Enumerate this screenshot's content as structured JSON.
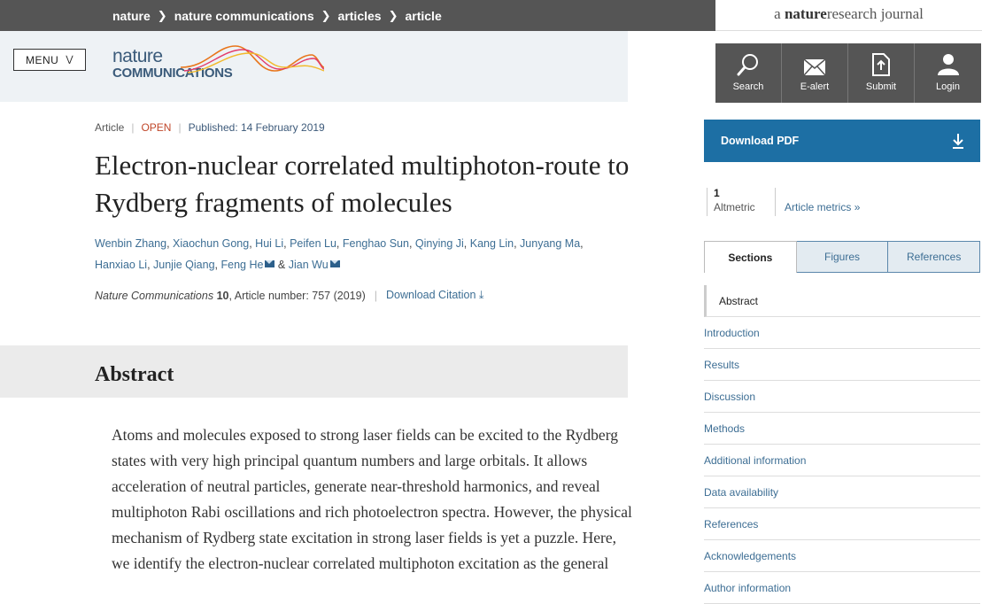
{
  "breadcrumb": [
    "nature",
    "nature communications",
    "articles",
    "article"
  ],
  "network_logo": {
    "prefix": "a",
    "brand_bold": "nature",
    "brand_rest": "research",
    "suffix": "journal"
  },
  "menu_label": "MENU",
  "journal_logo": {
    "line1": "nature",
    "line2": "COMMUNICATIONS"
  },
  "toolbar": [
    {
      "label": "Search",
      "icon": "search-icon"
    },
    {
      "label": "E-alert",
      "icon": "envelope-icon"
    },
    {
      "label": "Submit",
      "icon": "upload-icon"
    },
    {
      "label": "Login",
      "icon": "user-icon"
    }
  ],
  "article": {
    "type": "Article",
    "access": "OPEN",
    "published": "Published: 14 February 2019",
    "title": "Electron-nuclear correlated multiphoton-route to Rydberg fragments of molecules",
    "authors": [
      {
        "name": "Wenbin Zhang",
        "mail": false
      },
      {
        "name": "Xiaochun Gong",
        "mail": false
      },
      {
        "name": "Hui Li",
        "mail": false
      },
      {
        "name": "Peifen Lu",
        "mail": false
      },
      {
        "name": "Fenghao Sun",
        "mail": false
      },
      {
        "name": "Qinying Ji",
        "mail": false
      },
      {
        "name": "Kang Lin",
        "mail": false
      },
      {
        "name": "Junyang Ma",
        "mail": false
      },
      {
        "name": "Hanxiao Li",
        "mail": false
      },
      {
        "name": "Junjie Qiang",
        "mail": false
      },
      {
        "name": "Feng He",
        "mail": true
      },
      {
        "name": "Jian Wu",
        "mail": true
      }
    ],
    "journal": "Nature Communications",
    "volume": "10",
    "article_number": ", Article number: 757 (2019)",
    "download_citation": "Download Citation"
  },
  "abstract": {
    "heading": "Abstract",
    "text": "Atoms and molecules exposed to strong laser fields can be excited to the Rydberg states with very high principal quantum numbers and large orbitals. It allows acceleration of neutral particles, generate near-threshold harmonics, and reveal multiphoton Rabi oscillations and rich photoelectron spectra. However, the physical mechanism of Rydberg state excitation in strong laser fields is yet a puzzle. Here, we identify the electron-nuclear correlated multiphoton excitation as the general"
  },
  "sidebar": {
    "download_pdf": "Download PDF",
    "altmetric_score": "1",
    "altmetric_label": "Altmetric",
    "article_metrics": "Article metrics",
    "tabs": [
      "Sections",
      "Figures",
      "References"
    ],
    "sections": [
      "Abstract",
      "Introduction",
      "Results",
      "Discussion",
      "Methods",
      "Additional information",
      "Data availability",
      "References",
      "Acknowledgements",
      "Author information"
    ]
  },
  "colors": {
    "accent": "#1d6fa4",
    "link": "#3d6e94",
    "open": "#c0472a",
    "dark_bar": "#555555"
  }
}
